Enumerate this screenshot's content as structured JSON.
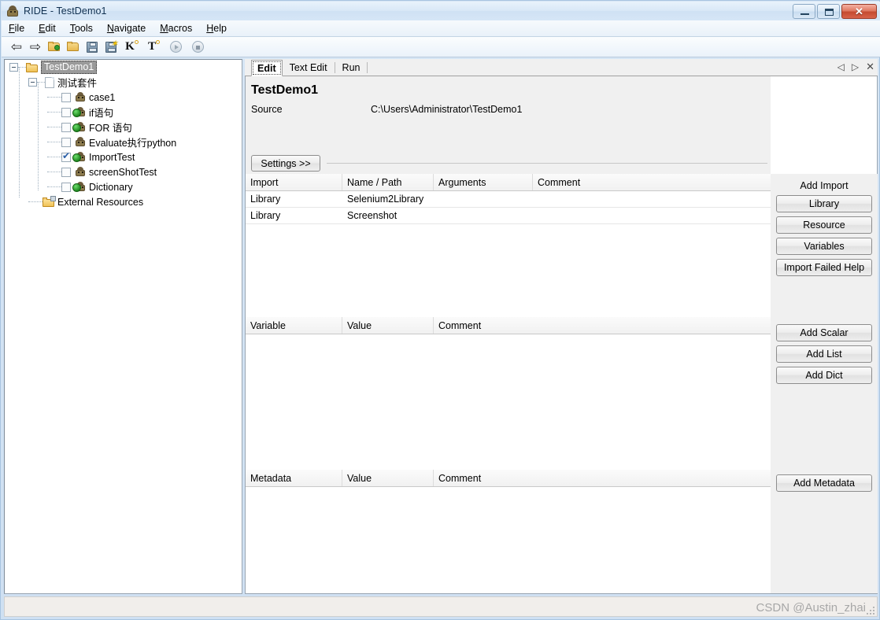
{
  "window": {
    "title": "RIDE - TestDemo1",
    "app_icon": "robot-icon",
    "minimize_label": "Minimize",
    "maximize_label": "Maximize",
    "close_label": "✕"
  },
  "menu": {
    "items": [
      {
        "label": "File",
        "accel": "F"
      },
      {
        "label": "Edit",
        "accel": "E"
      },
      {
        "label": "Tools",
        "accel": "T"
      },
      {
        "label": "Navigate",
        "accel": "N"
      },
      {
        "label": "Macros",
        "accel": "M"
      },
      {
        "label": "Help",
        "accel": "H"
      }
    ]
  },
  "toolbar": {
    "buttons": [
      {
        "name": "back-arrow-icon",
        "glyph": "⇦"
      },
      {
        "name": "forward-arrow-icon",
        "glyph": "⇨"
      },
      {
        "name": "open-new-project-icon",
        "glyph": ""
      },
      {
        "name": "open-folder-icon",
        "glyph": ""
      },
      {
        "name": "save-icon",
        "glyph": ""
      },
      {
        "name": "save-all-icon",
        "glyph": ""
      },
      {
        "name": "search-keyword-icon",
        "glyph": "K"
      },
      {
        "name": "search-test-icon",
        "glyph": "T"
      },
      {
        "name": "run-icon",
        "glyph": "▶"
      },
      {
        "name": "stop-icon",
        "glyph": "■"
      }
    ]
  },
  "tree": {
    "nodes": [
      {
        "label": "TestDemo1",
        "icon": "folder-icon",
        "depth": 0,
        "selected": true,
        "expander": true,
        "checkbox": false,
        "robot": false,
        "green": false
      },
      {
        "label": "测试套件",
        "icon": "document-icon",
        "depth": 1,
        "selected": false,
        "expander": true,
        "checkbox": false,
        "robot": false,
        "green": false
      },
      {
        "label": "case1",
        "icon": "robot-icon",
        "depth": 2,
        "selected": false,
        "expander": false,
        "checkbox": true,
        "checked": false,
        "robot": true,
        "green": false
      },
      {
        "label": "if语句",
        "icon": "robot-icon",
        "depth": 2,
        "selected": false,
        "expander": false,
        "checkbox": true,
        "checked": false,
        "robot": true,
        "green": true
      },
      {
        "label": "FOR 语句",
        "icon": "robot-icon",
        "depth": 2,
        "selected": false,
        "expander": false,
        "checkbox": true,
        "checked": false,
        "robot": true,
        "green": true
      },
      {
        "label": "Evaluate执行python",
        "icon": "robot-icon",
        "depth": 2,
        "selected": false,
        "expander": false,
        "checkbox": true,
        "checked": false,
        "robot": true,
        "green": false
      },
      {
        "label": "ImportTest",
        "icon": "robot-icon",
        "depth": 2,
        "selected": false,
        "expander": false,
        "checkbox": true,
        "checked": true,
        "robot": true,
        "green": true
      },
      {
        "label": "screenShotTest",
        "icon": "robot-icon",
        "depth": 2,
        "selected": false,
        "expander": false,
        "checkbox": true,
        "checked": false,
        "robot": true,
        "green": false
      },
      {
        "label": "Dictionary",
        "icon": "robot-icon",
        "depth": 2,
        "selected": false,
        "expander": false,
        "checkbox": true,
        "checked": false,
        "robot": true,
        "green": true
      },
      {
        "label": "External Resources",
        "icon": "resource-folder-icon",
        "depth": 1,
        "selected": false,
        "expander": false,
        "checkbox": false,
        "robot": false,
        "green": false
      }
    ]
  },
  "editor": {
    "tabs": [
      {
        "label": "Edit",
        "active": true
      },
      {
        "label": "Text Edit",
        "active": false
      },
      {
        "label": "Run",
        "active": false
      }
    ],
    "tab_nav": {
      "prev": "◁",
      "next": "▷",
      "close": "✕"
    },
    "title": "TestDemo1",
    "source_label": "Source",
    "source_value": "C:\\Users\\Administrator\\TestDemo1",
    "settings_button": "Settings >>"
  },
  "imports_grid": {
    "columns": [
      "Import",
      "Name / Path",
      "Arguments",
      "Comment"
    ],
    "rows": [
      [
        "Library",
        "Selenium2Library",
        "",
        ""
      ],
      [
        "Library",
        "Screenshot",
        "",
        ""
      ]
    ]
  },
  "imports_side": {
    "title": "Add Import",
    "buttons": [
      "Library",
      "Resource",
      "Variables",
      "Import Failed Help"
    ]
  },
  "variables_grid": {
    "columns": [
      "Variable",
      "Value",
      "Comment"
    ],
    "rows": []
  },
  "variables_side": {
    "buttons": [
      "Add Scalar",
      "Add List",
      "Add Dict"
    ]
  },
  "metadata_grid": {
    "columns": [
      "Metadata",
      "Value",
      "Comment"
    ],
    "rows": []
  },
  "metadata_side": {
    "buttons": [
      "Add Metadata"
    ]
  },
  "status_bar": {
    "watermark": "CSDN @Austin_zhai"
  },
  "colors": {
    "window_frame": "#cfe0f2",
    "titlebar_text": "#103050",
    "panel_bg": "#f0f0f0",
    "grid_bg": "#ffffff",
    "selection_bg": "#9a9a9a",
    "close_button": "#c44a30",
    "green_status": "#1f8a1f",
    "watermark": "#a7a7a7"
  }
}
